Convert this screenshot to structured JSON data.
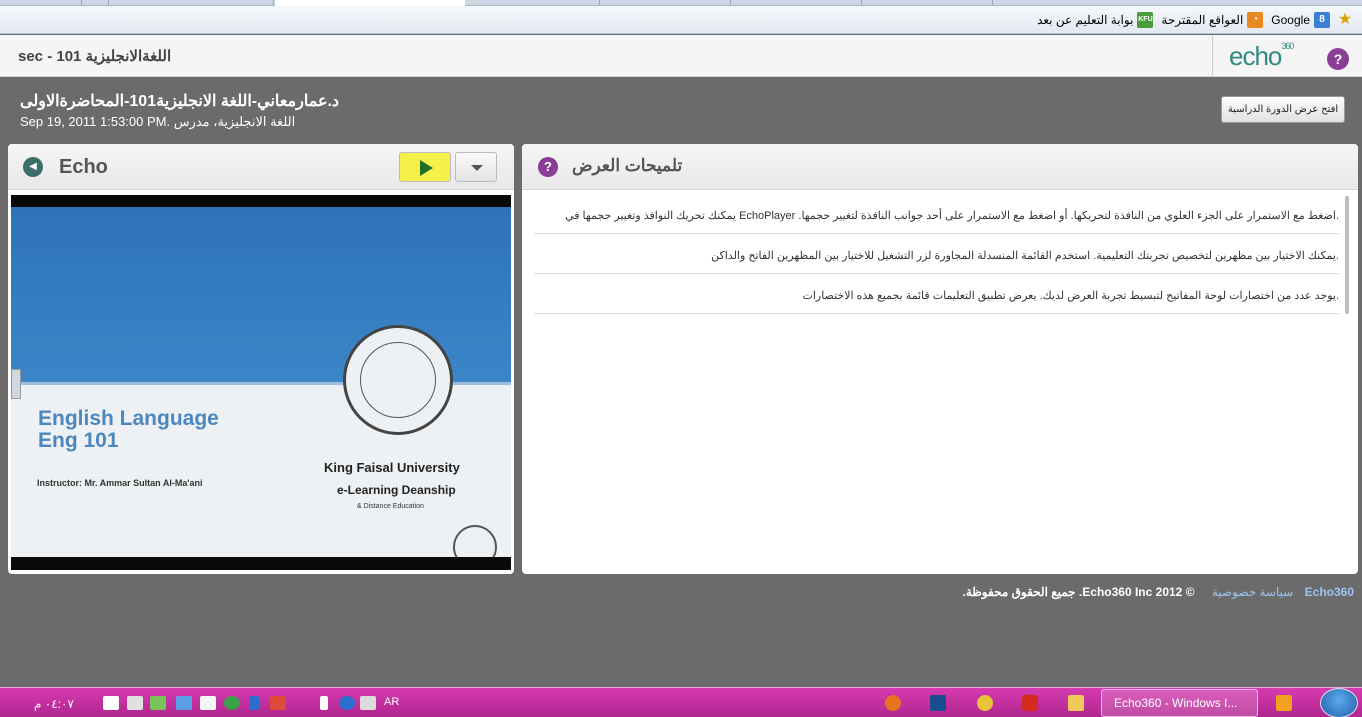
{
  "browser": {
    "favorites": [
      {
        "label": "Google",
        "icon": "google-icon",
        "color": "#3a7fd5"
      },
      {
        "label": "العواقع المقترحة",
        "icon": "rss-icon",
        "color": "#e8891f"
      },
      {
        "label": "بوابة التعليم عن بعد",
        "icon": "kfu-icon",
        "color": "#4a9c3b",
        "icon_text": "KFU"
      }
    ]
  },
  "header": {
    "course_title": "sec - اللغةالانجليزية 101",
    "logo": "echo",
    "logo_sup": "360",
    "help_symbol": "?"
  },
  "presentation": {
    "title": "د.عمارمعاني-اللغة الانجليزية101-المحاضرةالاولى",
    "meta": "Sep 19, 2011 1:53:00 PM. اللغة الانجليزية، مدرس",
    "open_course_label": "افتح عرض الدورة الدراسية"
  },
  "player": {
    "label": "Echo",
    "slide": {
      "line1": "English Language",
      "line2": "Eng 101",
      "instructor": "Instructor: Mr. Ammar Sultan Al-Ma'ani",
      "university": "King Faisal University",
      "eLearning": "e-Learning Deanship",
      "distance": "& Distance Education"
    }
  },
  "tips": {
    "title": "تلميحات العرض",
    "icon_symbol": "?",
    "items": [
      ".اضغط مع الاستمرار على الجزء العلوي من النافذة لتحريكها. أو اضغط مع الاستمرار على أحد جوانب النافذة لتغيير حجمها. EchoPlayer يمكنك تحريك النوافذ وتغيير حجمها في",
      ".يمكنك الاختيار بين مظهرين لتخصيص تجربتك التعليمية. استخدم القائمة المنسدلة المجاورة لزر التشغيل للاختيار بين المظهرين الفاتح والداكن",
      ".يوجد عدد من اختصارات لوحة المفاتيح لتبسيط تجربة العرض لديك. يعرض تطبيق التعليمات قائمة بجميع هذه الاختصارات"
    ]
  },
  "footer": {
    "brand": "Echo360",
    "privacy": "سياسة خصوصية",
    "copyright": "© 2012 Echo360 Inc. جميع الحقوق محفوظة."
  },
  "taskbar": {
    "clock": "٠٤:٠٧ م",
    "language": "AR",
    "active_window": "Echo360 - Windows I...",
    "colors": {
      "bar": "#c2309f"
    }
  }
}
